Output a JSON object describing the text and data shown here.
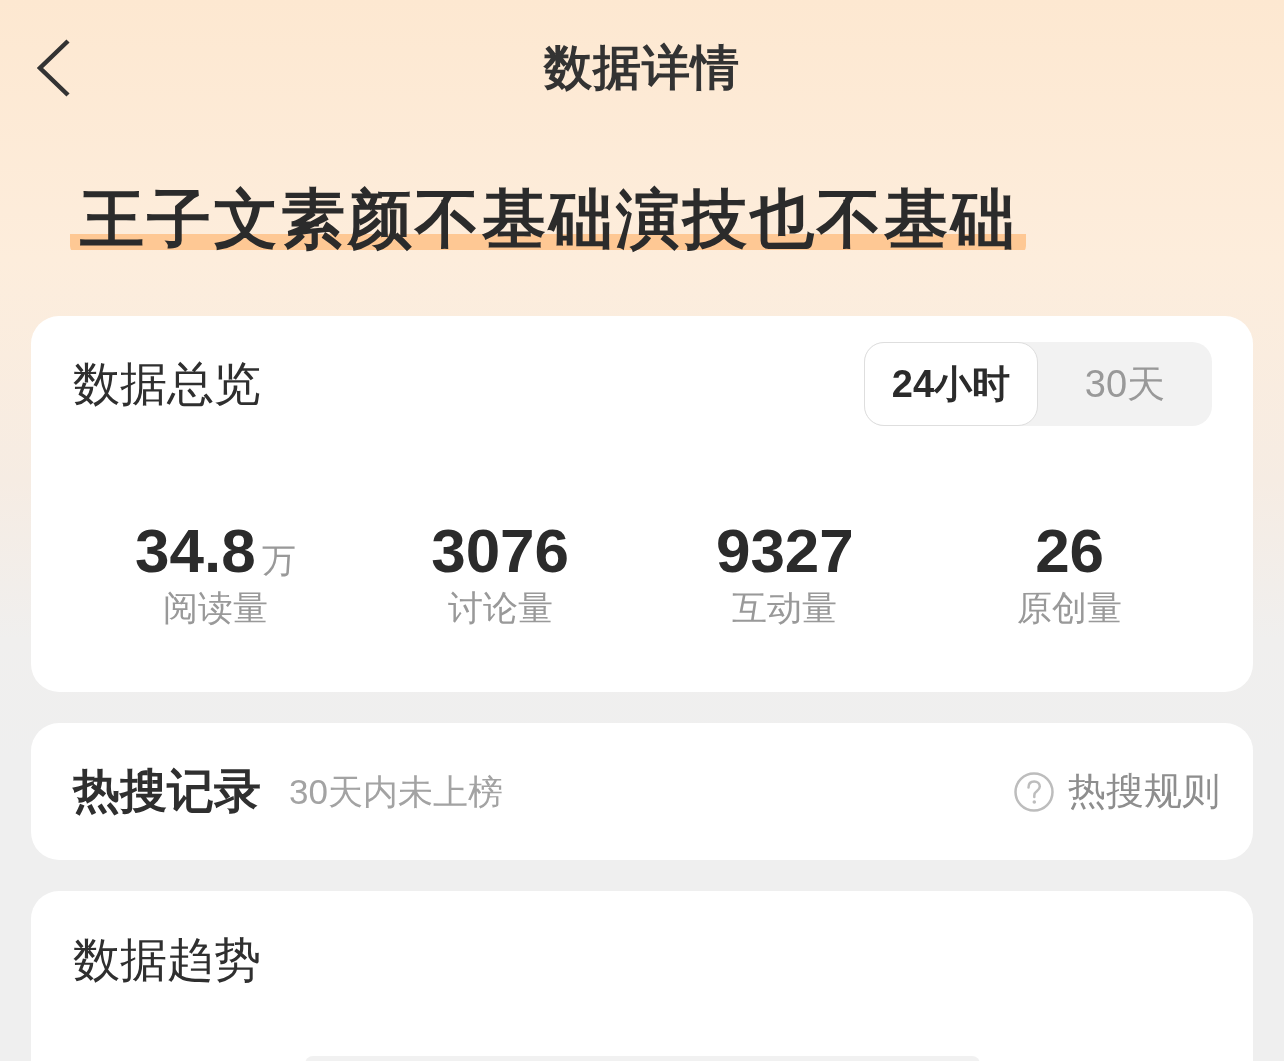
{
  "header": {
    "title": "数据详情"
  },
  "topic": {
    "title": "王子文素颜不基础演技也不基础"
  },
  "overview": {
    "title": "数据总览",
    "periods": [
      {
        "label": "24小时",
        "selected": true
      },
      {
        "label": "30天",
        "selected": false
      }
    ],
    "stats": [
      {
        "value": "34.8",
        "unit": "万",
        "label": "阅读量"
      },
      {
        "value": "3076",
        "label": "讨论量"
      },
      {
        "value": "9327",
        "label": "互动量"
      },
      {
        "value": "26",
        "label": "原创量"
      }
    ]
  },
  "hot_search": {
    "title": "热搜记录",
    "status": "30天内未上榜",
    "rules_link": "热搜规则"
  },
  "trend": {
    "title": "数据趋势"
  }
}
